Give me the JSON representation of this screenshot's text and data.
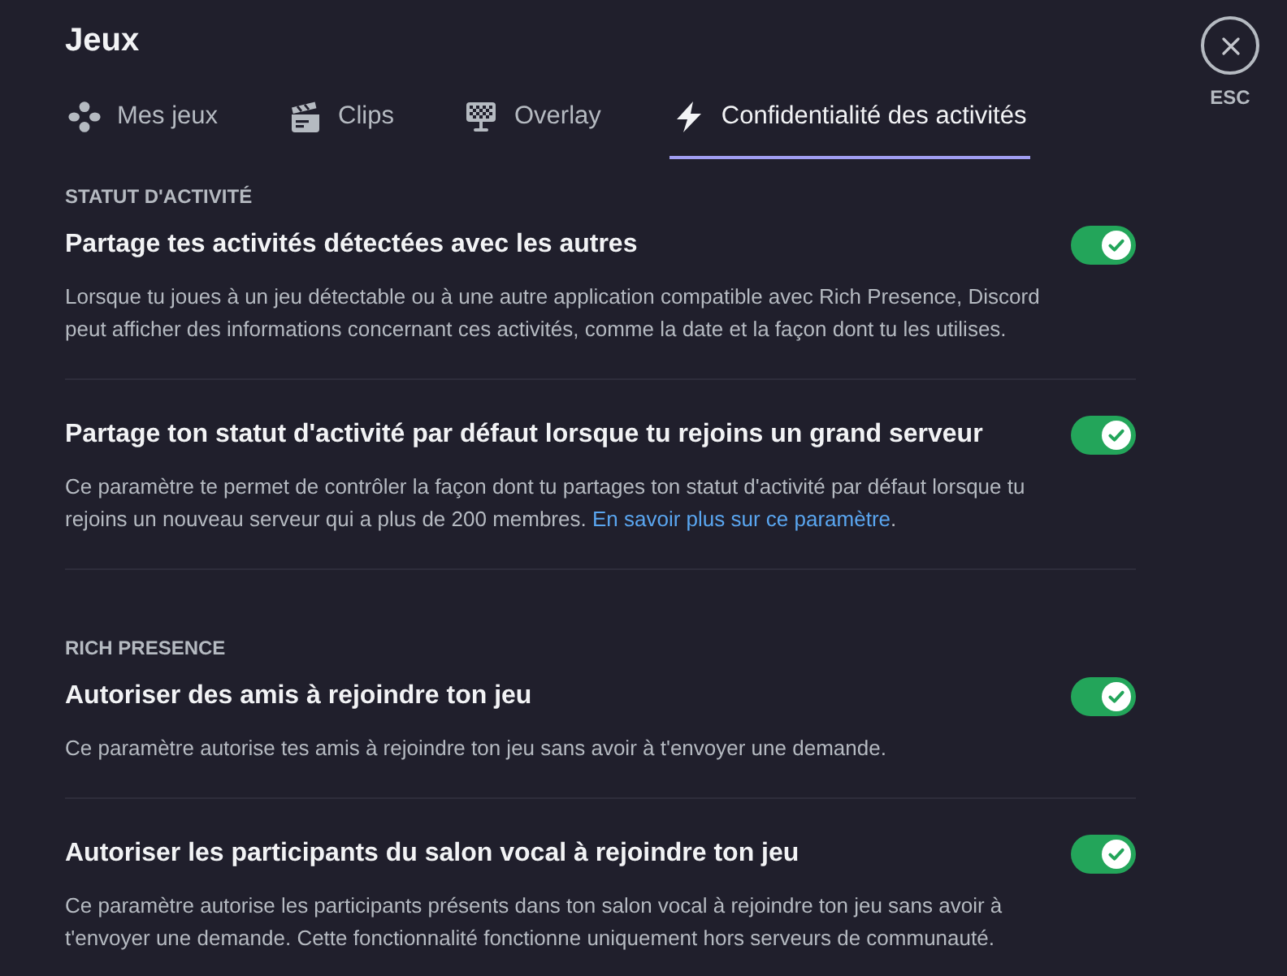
{
  "page": {
    "title": "Jeux",
    "close_hint": "ESC"
  },
  "tabs": [
    {
      "label": "Mes jeux",
      "selected": false
    },
    {
      "label": "Clips",
      "selected": false
    },
    {
      "label": "Overlay",
      "selected": false
    },
    {
      "label": "Confidentialité des activités",
      "selected": true
    }
  ],
  "sections": [
    {
      "heading": "STATUT D'ACTIVITÉ",
      "settings": [
        {
          "title": "Partage tes activités détectées avec les autres",
          "description": "Lorsque tu joues à un jeu détectable ou à une autre application compatible avec Rich Presence, Discord peut afficher des informations concernant ces activités, comme la date et la façon dont tu les utilises.",
          "on": true
        },
        {
          "title": "Partage ton statut d'activité par défaut lorsque tu rejoins un grand serveur",
          "description": "Ce paramètre te permet de contrôler la façon dont tu partages ton statut d'activité par défaut lorsque tu rejoins un nouveau serveur qui a plus de 200 membres.",
          "link": "En savoir plus sur ce paramètre",
          "link_suffix": ".",
          "on": true
        }
      ]
    },
    {
      "heading": "RICH PRESENCE",
      "settings": [
        {
          "title": "Autoriser des amis à rejoindre ton jeu",
          "description": "Ce paramètre autorise tes amis à rejoindre ton jeu sans avoir à t'envoyer une demande.",
          "on": true
        },
        {
          "title": "Autoriser les participants du salon vocal à rejoindre ton jeu",
          "description": "Ce paramètre autorise les participants présents dans ton salon vocal à rejoindre ton jeu sans avoir à t'envoyer une demande. Cette fonctionnalité fonctionne uniquement hors serveurs de communauté.",
          "on": true
        }
      ]
    }
  ]
}
